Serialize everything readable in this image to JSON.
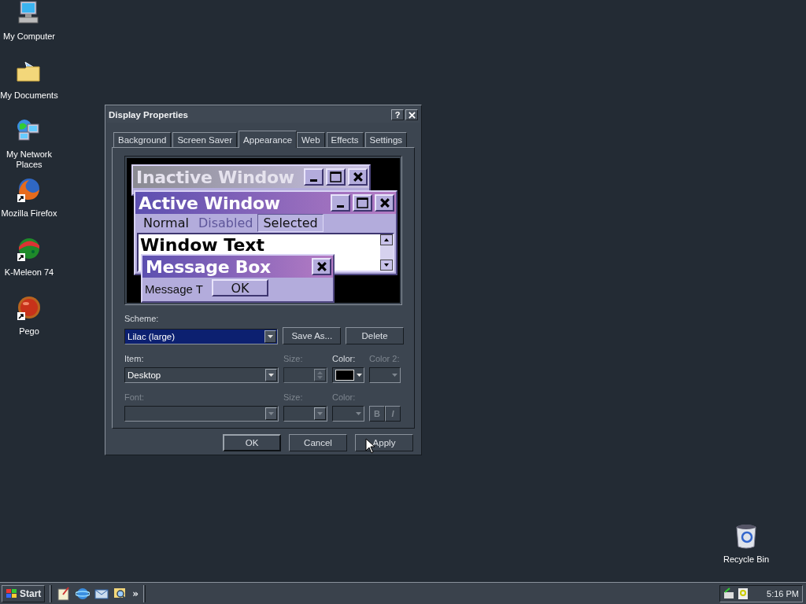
{
  "desktop_icons": [
    {
      "label": "My Computer",
      "kind": "computer",
      "shortcut": false
    },
    {
      "label": "My Documents",
      "kind": "documents",
      "shortcut": false
    },
    {
      "label": "My Network Places",
      "kind": "network",
      "shortcut": false
    },
    {
      "label": "Mozilla Firefox",
      "kind": "firefox",
      "shortcut": true
    },
    {
      "label": "K-Meleon 74",
      "kind": "kmeleon",
      "shortcut": true
    },
    {
      "label": "Pego",
      "kind": "pego",
      "shortcut": true
    }
  ],
  "recycle_bin": {
    "label": "Recycle Bin"
  },
  "dialog": {
    "title": "Display Properties",
    "help": "?",
    "tabs": [
      {
        "label": "Background",
        "selected": false
      },
      {
        "label": "Screen Saver",
        "selected": false
      },
      {
        "label": "Appearance",
        "selected": true
      },
      {
        "label": "Web",
        "selected": false
      },
      {
        "label": "Effects",
        "selected": false
      },
      {
        "label": "Settings",
        "selected": false
      }
    ],
    "preview": {
      "inactive_title": "Inactive Window",
      "active_title": "Active Window",
      "menu": [
        {
          "label": "Normal",
          "disabled": false,
          "selected": false
        },
        {
          "label": "Disabled",
          "disabled": true,
          "selected": false
        },
        {
          "label": "Selected",
          "disabled": false,
          "selected": true
        }
      ],
      "window_text": "Window Text",
      "message_title": "Message Box",
      "message_text": "Message T",
      "ok": "OK"
    },
    "scheme": {
      "label": "Scheme:",
      "value": "Lilac (large)",
      "save_as": "Save As...",
      "delete": "Delete"
    },
    "item_row": {
      "item_label": "Item:",
      "item_value": "Desktop",
      "size_label": "Size:",
      "size_disabled": true,
      "color_label": "Color:",
      "color": "#000000",
      "color2_label": "Color 2:",
      "color2_disabled": true
    },
    "font_row": {
      "font_label": "Font:",
      "size_label": "Size:",
      "color_label": "Color:",
      "disabled": true,
      "bold": "B",
      "italic": "I"
    },
    "buttons": [
      {
        "label": "OK",
        "default": true
      },
      {
        "label": "Cancel",
        "default": false
      },
      {
        "label": "Apply",
        "default": false
      }
    ]
  },
  "taskbar": {
    "start": "Start",
    "quick_launch": [
      {
        "kind": "notepad"
      },
      {
        "kind": "browser"
      },
      {
        "kind": "mail"
      },
      {
        "kind": "search"
      }
    ],
    "chevron": "»",
    "clock": "5:16 PM"
  }
}
